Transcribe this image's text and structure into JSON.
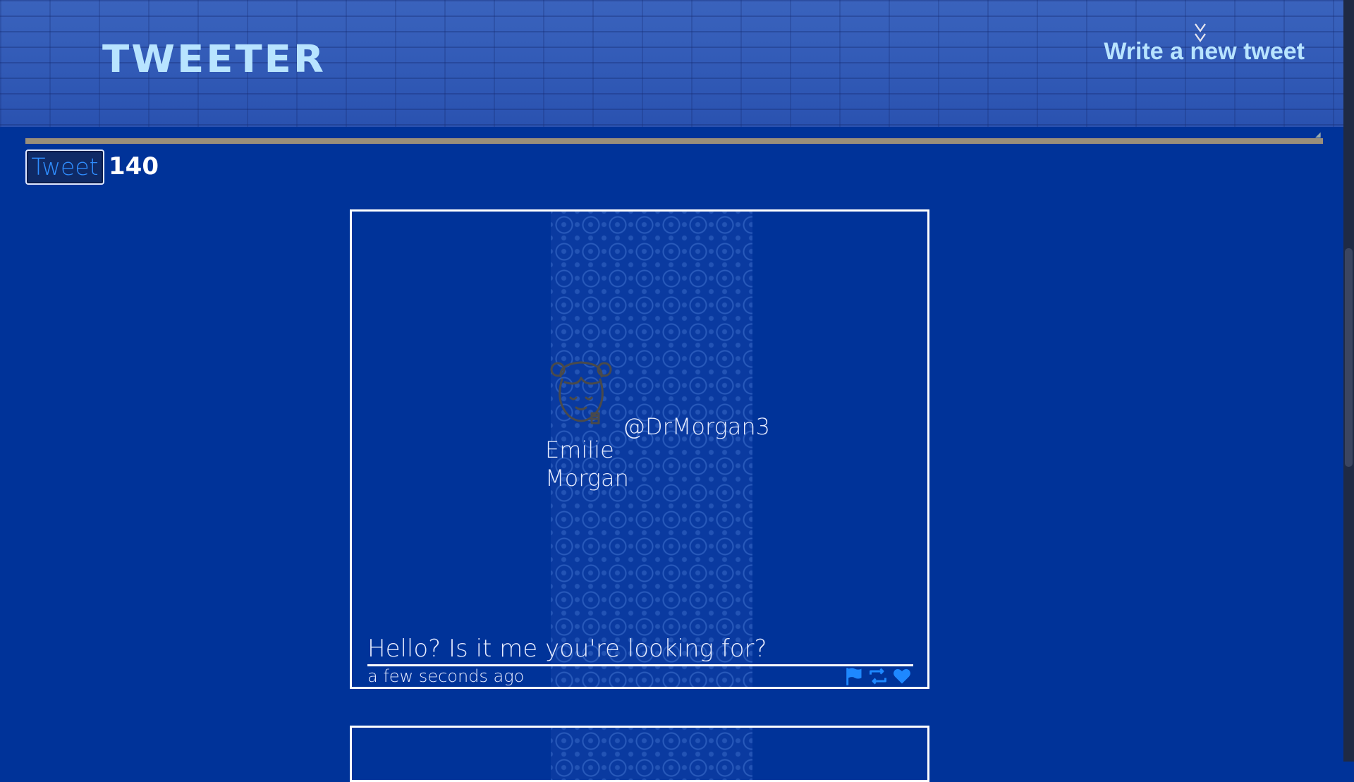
{
  "nav": {
    "logo": "Tweeter",
    "compose_label": "Write a new tweet",
    "chevrons": "v\nv"
  },
  "composer": {
    "button_label": "Tweet",
    "counter": "140"
  },
  "tweets": [
    {
      "fullname": "Emilie Morgan",
      "handle": "@DrMorgan3",
      "content": "Hello? Is it me you're looking for?",
      "time": "a few seconds ago",
      "actions": [
        "flag-icon",
        "retweet-icon",
        "heart-icon"
      ]
    }
  ],
  "colors": {
    "background": "#003399",
    "nav": "#2f58b4",
    "logo": "#b8e4ff",
    "accent": "#1e88ff",
    "avatar_stroke": "#4a4a4a"
  }
}
